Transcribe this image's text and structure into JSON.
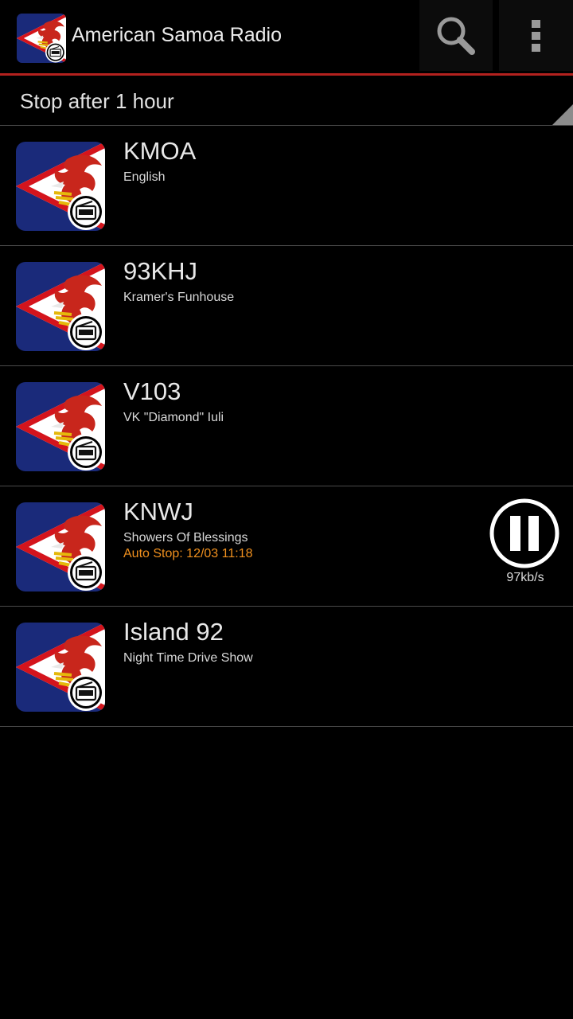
{
  "app": {
    "title": "American Samoa Radio",
    "icon": "american-samoa-flag-radio-icon",
    "accent_color": "#b3211e"
  },
  "actionbar": {
    "search_icon": "search-icon",
    "overflow_icon": "overflow-menu-icon"
  },
  "sleep_timer": {
    "selected": "Stop after 1 hour"
  },
  "stations": [
    {
      "name": "KMOA",
      "subtitle": "English"
    },
    {
      "name": "93KHJ",
      "subtitle": "Kramer's Funhouse"
    },
    {
      "name": "V103",
      "subtitle": "VK \"Diamond\" Iuli"
    },
    {
      "name": "KNWJ",
      "subtitle": "Showers Of Blessings",
      "auto_stop": "Auto Stop: 12/03 11:18",
      "playing": true,
      "bitrate": "97kb/s",
      "control_icon": "pause-icon"
    },
    {
      "name": "Island 92",
      "subtitle": "Night Time Drive Show"
    }
  ],
  "colors": {
    "background": "#000000",
    "auto_stop_text": "#f0901e",
    "divider": "#4a4a4a"
  }
}
